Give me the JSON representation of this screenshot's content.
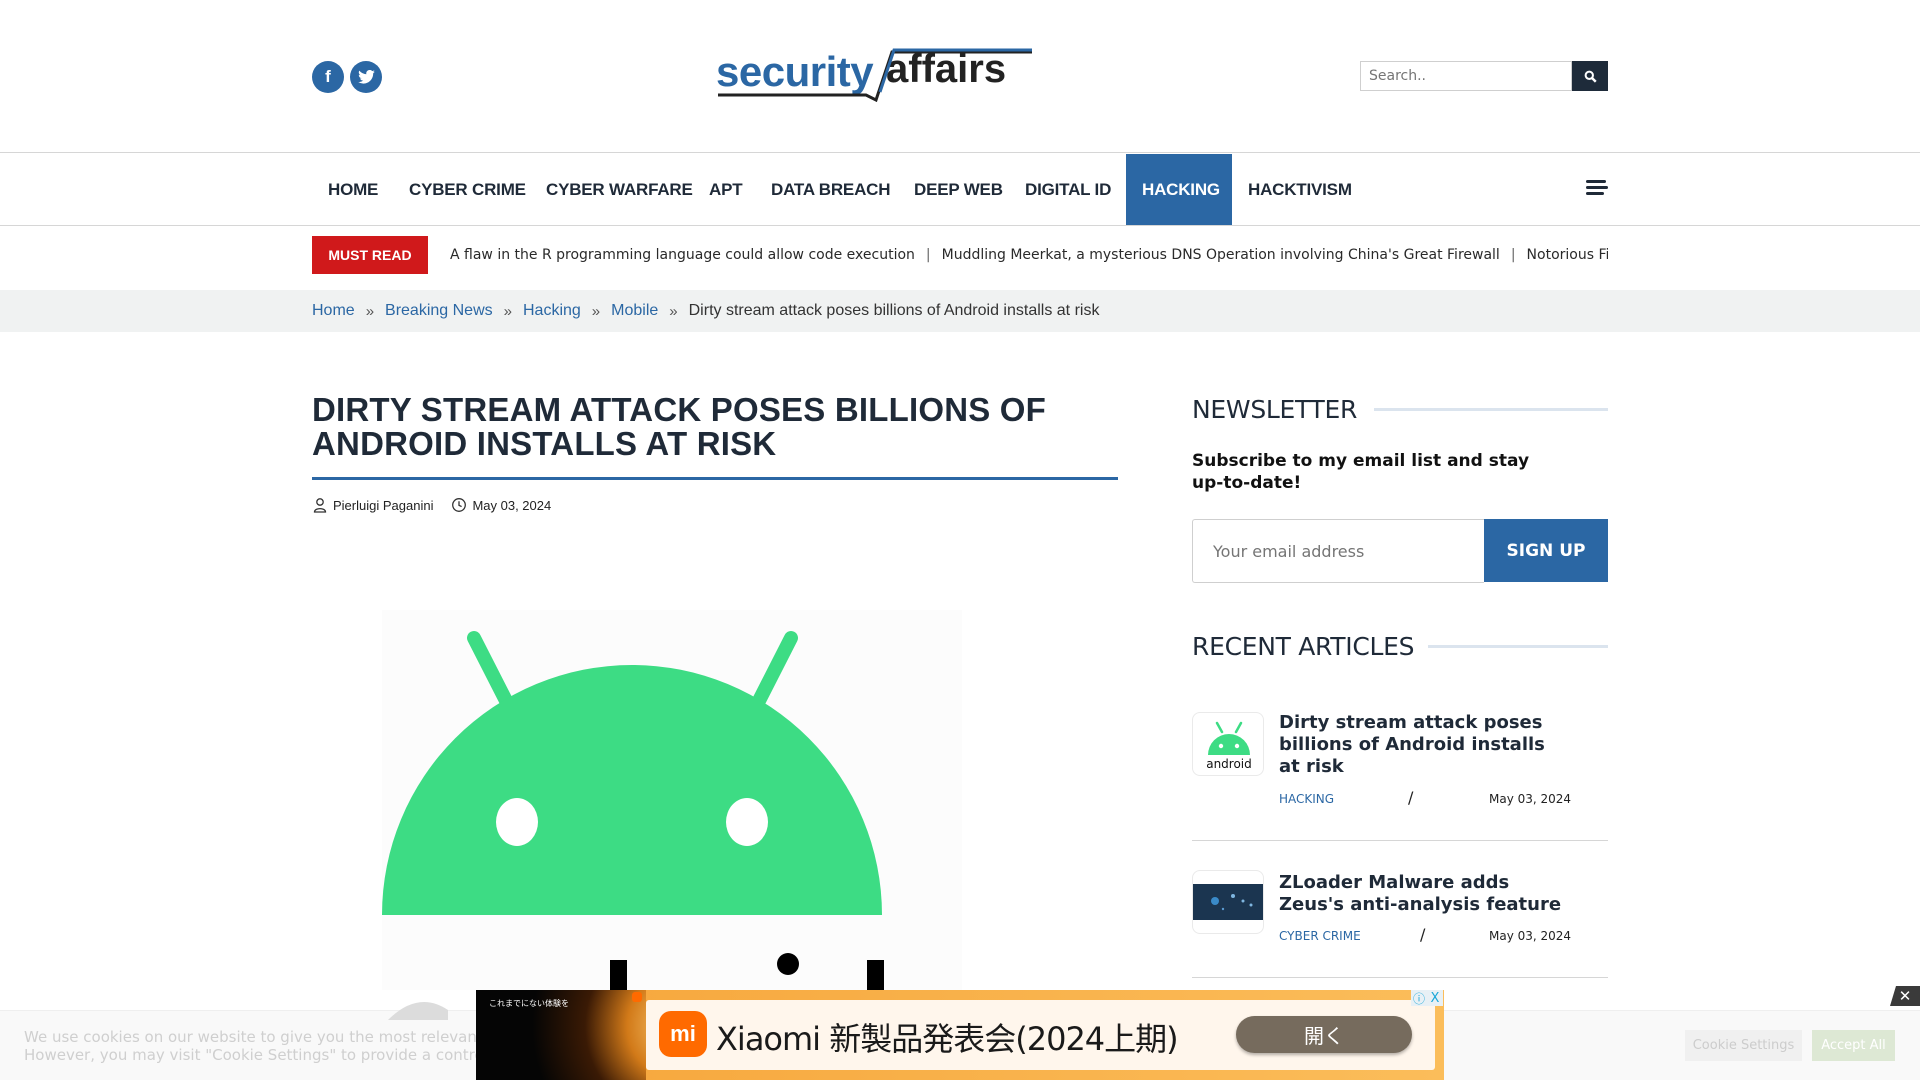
{
  "header": {
    "social": [
      {
        "name": "facebook",
        "glyph": "f"
      },
      {
        "name": "twitter",
        "glyph": "t"
      }
    ],
    "logo": {
      "part1": "security",
      "part2": "affairs"
    },
    "search": {
      "placeholder": "Search..",
      "value": ""
    }
  },
  "nav": {
    "items": [
      {
        "label": "HOME",
        "active": false
      },
      {
        "label": "CYBER CRIME",
        "active": false
      },
      {
        "label": "CYBER WARFARE",
        "active": false
      },
      {
        "label": "APT",
        "active": false
      },
      {
        "label": "DATA BREACH",
        "active": false
      },
      {
        "label": "DEEP WEB",
        "active": false
      },
      {
        "label": "DIGITAL ID",
        "active": false
      },
      {
        "label": "HACKING",
        "active": true
      },
      {
        "label": "HACKTIVISM",
        "active": false
      }
    ]
  },
  "must_read": {
    "label": "MUST READ",
    "headlines": [
      "A flaw in the R programming language could allow code execution",
      "Muddling Meerkat, a mysterious DNS Operation involving China's Great Firewall",
      "Notorious Finnish Hacke"
    ],
    "separator": "|"
  },
  "breadcrumb": {
    "items": [
      "Home",
      "Breaking News",
      "Hacking",
      "Mobile"
    ],
    "current": "Dirty stream attack poses billions of Android installs at risk",
    "separator": "»"
  },
  "article": {
    "title": "DIRTY STREAM ATTACK POSES BILLIONS OF ANDROID INSTALLS AT RISK",
    "author": "Pierluigi Paganini",
    "date": "May 03, 2024"
  },
  "sidebar": {
    "newsletter": {
      "heading": "NEWSLETTER",
      "text": "Subscribe to my email list and stay up-to-date!",
      "email_placeholder": "Your email address",
      "button": "SIGN UP"
    },
    "recent": {
      "heading": "RECENT ARTICLES",
      "items": [
        {
          "title": "Dirty stream attack poses billions of Android installs at risk",
          "category": "HACKING",
          "date": "May 03, 2024",
          "thumb_label": "android"
        },
        {
          "title": "ZLoader Malware adds Zeus's anti-analysis feature",
          "category": "CYBER CRIME",
          "date": "May 03, 2024"
        }
      ],
      "slash": "/"
    }
  },
  "cookie": {
    "line1": "We use cookies on our website to give you the most relevant experience by remembering your preferences and repeat visits.",
    "line2": "However, you may visit \"Cookie Settings\" to provide a controlled consent.",
    "settings": "Cookie Settings",
    "accept": "Accept All",
    "close": "✕"
  },
  "ad": {
    "side_text": "これまでにない体験を",
    "logo": "mi",
    "headline": "Xiaomi 新製品発表会(2024上期)",
    "button": "開く",
    "info": "ⓘ",
    "close": "X"
  },
  "colors": {
    "brand_blue": "#2b67a4",
    "must_read_red": "#d0191b",
    "android_green": "#3ddc84",
    "dark_navy": "#1f2a38"
  }
}
